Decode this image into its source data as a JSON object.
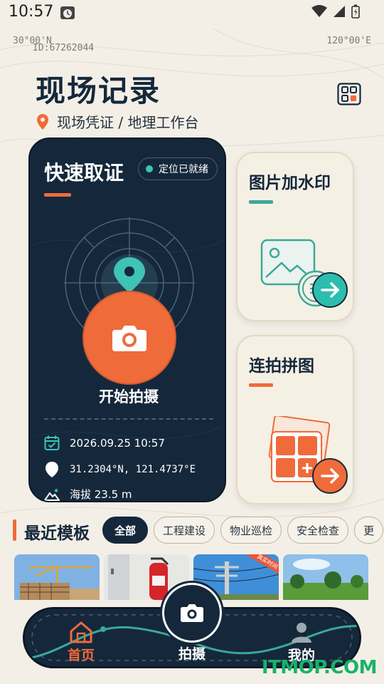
{
  "status_bar": {
    "time": "10:57"
  },
  "header": {
    "coord_left": "30°00'N",
    "coord_right": "120°00'E",
    "device_id": "ID:67262044",
    "title": "现场记录",
    "subtitle": "现场凭证 / 地理工作台"
  },
  "quick_card": {
    "title": "快速取证",
    "location_status": "定位已就绪",
    "shoot_label": "开始拍摄",
    "datetime": "2026.09.25 10:57",
    "coordinates": "31.2304°N, 121.4737°E",
    "altitude": "海拔 23.5 m"
  },
  "side_cards": [
    {
      "title": "图片加水印",
      "accent": "#3aa89a"
    },
    {
      "title": "连拍拼图",
      "accent": "#ef6b3a"
    }
  ],
  "recent": {
    "title": "最近模板",
    "chips": [
      "全部",
      "工程建设",
      "物业巡检",
      "安全检查",
      "更"
    ],
    "thumbs": [
      {
        "name": "construction-site"
      },
      {
        "name": "fire-extinguisher"
      },
      {
        "name": "power-line",
        "badge": "真实时间"
      },
      {
        "name": "field-landscape"
      }
    ]
  },
  "bottom_nav": {
    "home": "首页",
    "shoot": "拍摄",
    "mine": "我的"
  },
  "watermark": "ITMOP.COM",
  "colors": {
    "navy": "#15283b",
    "orange": "#ef6b3a",
    "teal": "#3aa89a",
    "cream": "#f3efe7"
  }
}
